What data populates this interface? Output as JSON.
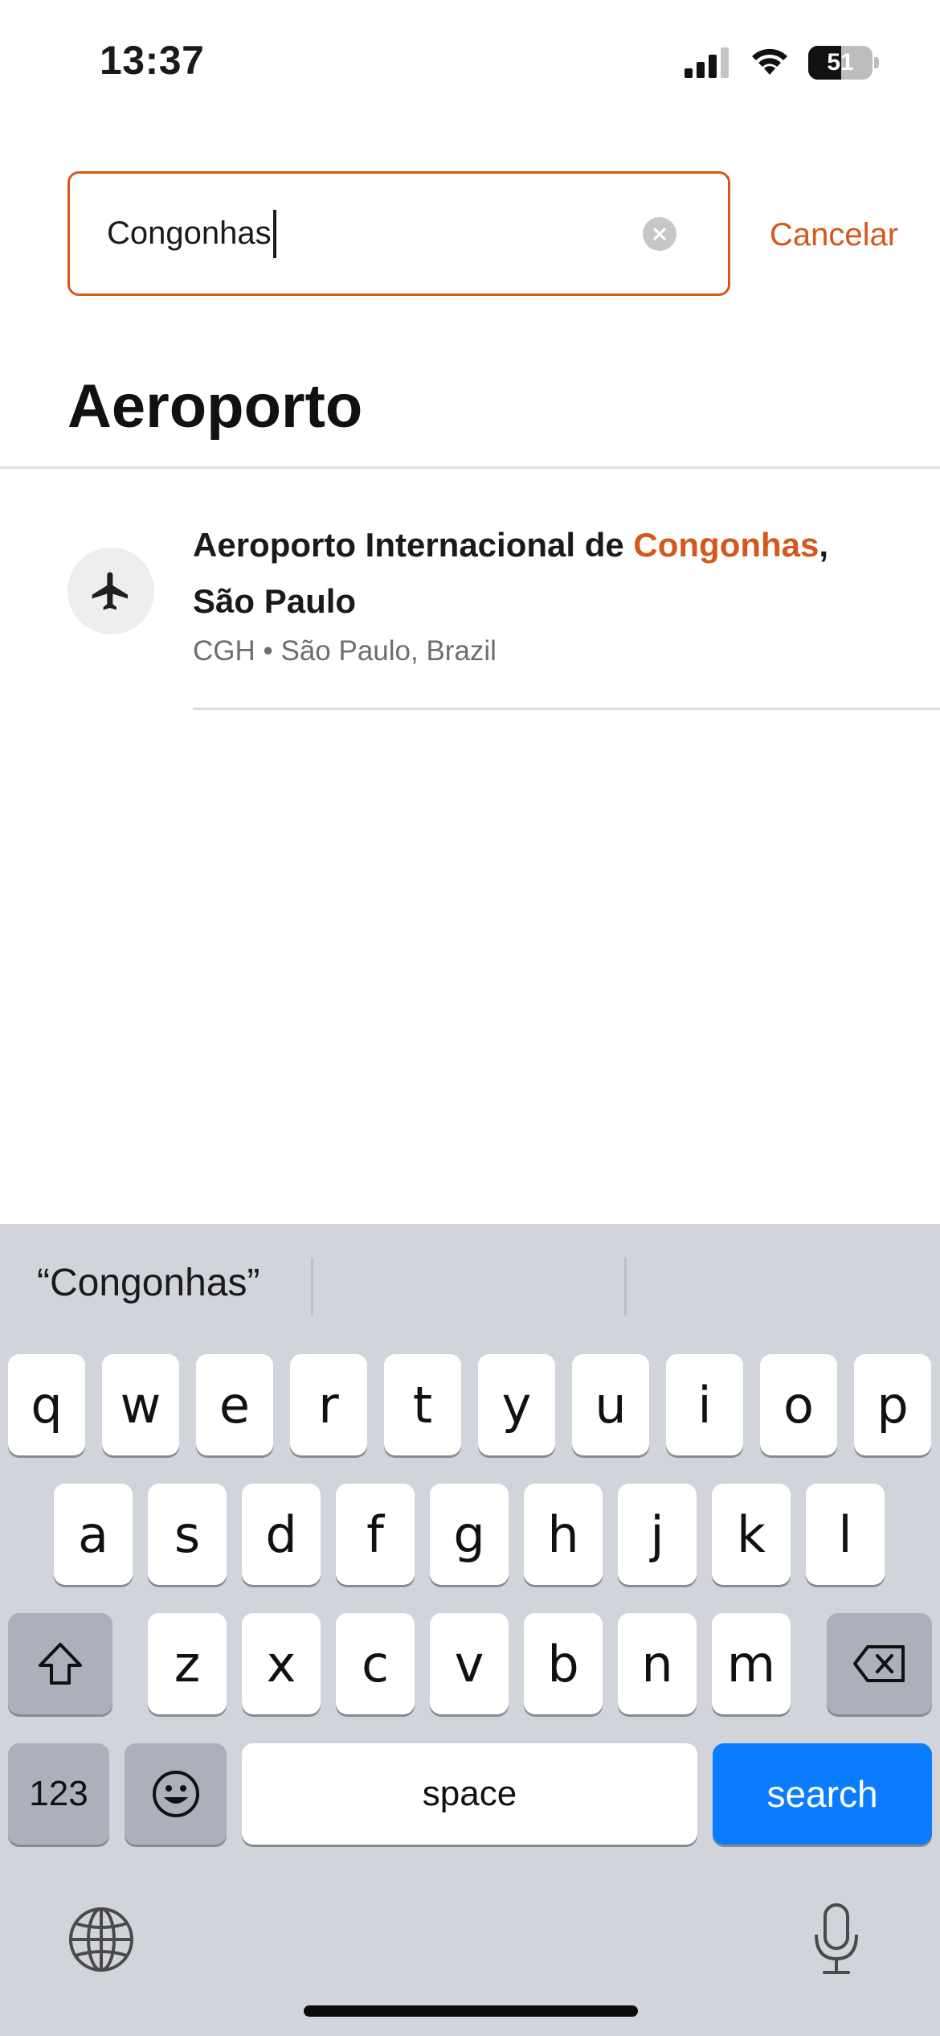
{
  "status_bar": {
    "time": "13:37",
    "battery": "51",
    "battery_level": 0.51,
    "icons": [
      "cellular-signal-icon",
      "wifi-icon",
      "battery-icon"
    ]
  },
  "search": {
    "value": "Congonhas",
    "clear_icon": "clear-icon",
    "cancel_label": "Cancelar"
  },
  "section": {
    "title": "Aeroporto"
  },
  "results": [
    {
      "icon": "airplane-icon",
      "title_before": "Aeroporto Internacional de ",
      "title_highlight": "Congonhas",
      "title_after": ",",
      "title_line2": "São Paulo",
      "subtitle": "CGH • São Paulo, Brazil"
    }
  ],
  "keyboard": {
    "suggestion": "“Congonhas”",
    "row1": [
      "q",
      "w",
      "e",
      "r",
      "t",
      "y",
      "u",
      "i",
      "o",
      "p"
    ],
    "row2": [
      "a",
      "s",
      "d",
      "f",
      "g",
      "h",
      "j",
      "k",
      "l"
    ],
    "row3": [
      "z",
      "x",
      "c",
      "v",
      "b",
      "n",
      "m"
    ],
    "numbers_label": "123",
    "space_label": "space",
    "search_label": "search",
    "colors": {
      "background": "#d1d4db",
      "key": "#ffffff",
      "dark_key": "#abb0bb",
      "action": "#0a7cff"
    }
  },
  "colors": {
    "accent": "#d4581c",
    "text": "#1a1a1a",
    "muted": "#6e6e6e"
  }
}
